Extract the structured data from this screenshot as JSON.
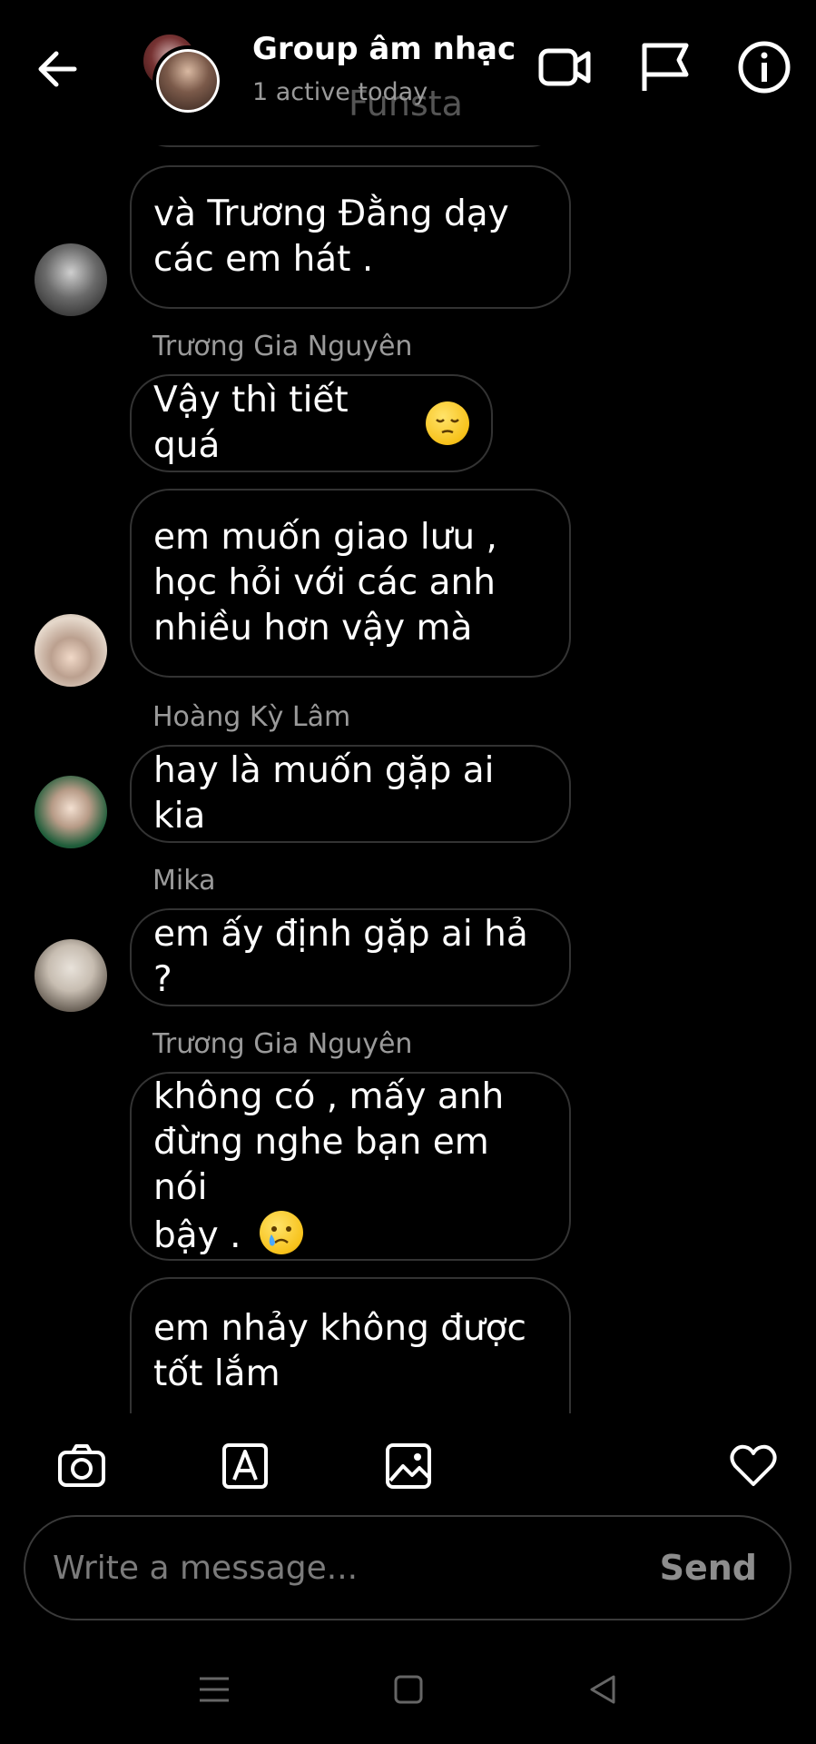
{
  "header": {
    "title": "Group âm nhạc",
    "subtitle": "1 active today",
    "ghost_text": "Funsta"
  },
  "messages": [
    {
      "text_line1": "và Trương Đằng dạy",
      "text_line2": "các em hát ."
    },
    {
      "sender": "Trương Gia Nguyên",
      "text": "Vậy thì tiết quá"
    },
    {
      "text_line1": "em muốn giao lưu ,",
      "text_line2": "học hỏi với các anh",
      "text_line3": "nhiều hơn vậy mà"
    },
    {
      "sender": "Hoàng Kỳ Lâm",
      "text": "hay là muốn gặp ai kia"
    },
    {
      "sender": "Mika",
      "text": "em ấy định gặp ai hả ?"
    },
    {
      "sender": "Trương Gia Nguyên",
      "text_line1": "không có , mấy anh",
      "text_line2": "đừng nghe bạn em nói",
      "text_line3": "bậy ."
    },
    {
      "text_line1": "em nhảy không được",
      "text_line2": "tốt lắm"
    }
  ],
  "composer": {
    "placeholder": "Write a message...",
    "send_label": "Send"
  },
  "icons": [
    "back-arrow-icon",
    "video-call-icon",
    "flag-icon",
    "info-icon",
    "camera-icon",
    "text-style-icon",
    "gallery-icon",
    "heart-icon",
    "menu-nav-icon",
    "home-nav-icon",
    "back-nav-icon"
  ]
}
